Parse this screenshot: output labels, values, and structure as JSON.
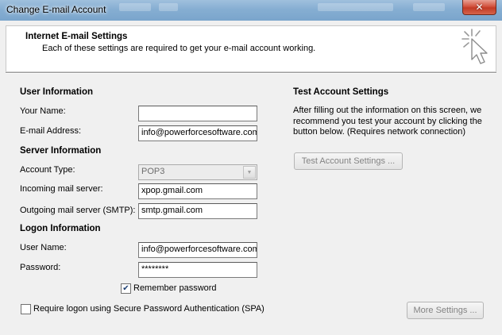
{
  "window": {
    "title": "Change E-mail Account",
    "close_symbol": "✕"
  },
  "header": {
    "title": "Internet E-mail Settings",
    "subtitle": "Each of these settings are required to get your e-mail account working.",
    "icon": "cursor-sparkle-icon"
  },
  "user_info": {
    "heading": "User Information",
    "name_label": "Your Name:",
    "name_value": "",
    "email_label": "E-mail Address:",
    "email_value": "info@powerforcesoftware.com"
  },
  "server_info": {
    "heading": "Server Information",
    "account_type_label": "Account Type:",
    "account_type_value": "POP3",
    "incoming_label": "Incoming mail server:",
    "incoming_value": "xpop.gmail.com",
    "outgoing_label": "Outgoing mail server (SMTP):",
    "outgoing_value": "smtp.gmail.com"
  },
  "logon_info": {
    "heading": "Logon Information",
    "username_label": "User Name:",
    "username_value": "info@powerforcesoftware.com",
    "password_label": "Password:",
    "password_value": "********",
    "remember_label": "Remember password",
    "remember_checked": true,
    "spa_label": "Require logon using Secure Password Authentication (SPA)",
    "spa_checked": false
  },
  "test_settings": {
    "heading": "Test Account Settings",
    "description": "After filling out the information on this screen, we recommend you test your account by clicking the button below. (Requires network connection)",
    "button_label": "Test Account Settings ..."
  },
  "more_settings": {
    "button_label": "More Settings ..."
  },
  "colors": {
    "title_bar": "#86aed2",
    "close_button": "#c23a25",
    "disabled_text": "#838383"
  }
}
